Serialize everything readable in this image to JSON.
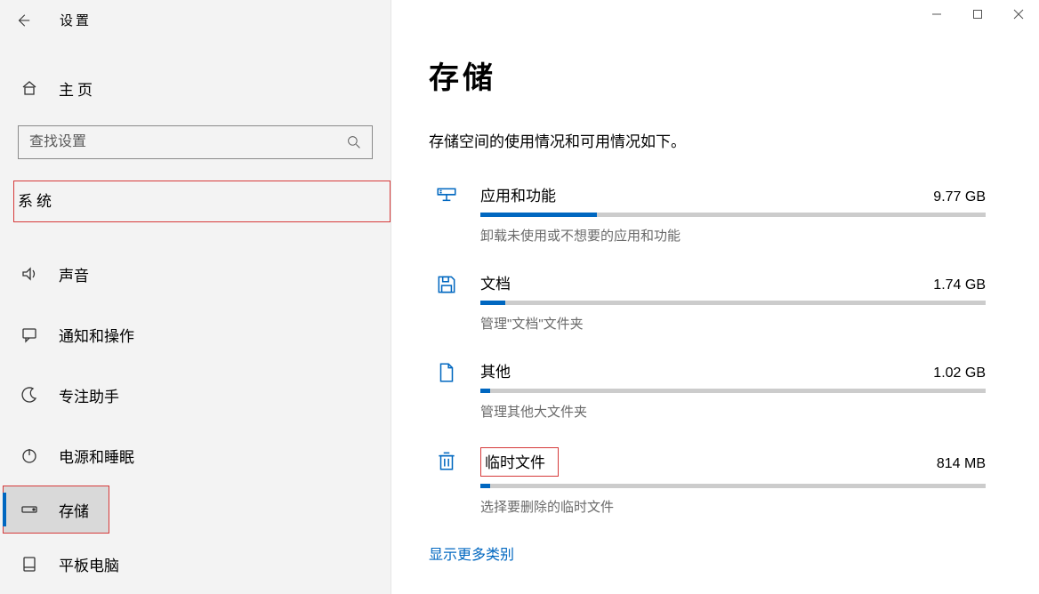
{
  "header": {
    "settings_label": "设置"
  },
  "home": {
    "label": "主页"
  },
  "search": {
    "placeholder": "查找设置"
  },
  "category_label": "系统",
  "nav": [
    {
      "key": "sound",
      "label": "声音"
    },
    {
      "key": "notify",
      "label": "通知和操作"
    },
    {
      "key": "focus",
      "label": "专注助手"
    },
    {
      "key": "power",
      "label": "电源和睡眠"
    },
    {
      "key": "storage",
      "label": "存储"
    },
    {
      "key": "tablet",
      "label": "平板电脑"
    }
  ],
  "page": {
    "title": "存储",
    "lede": "存储空间的使用情况和可用情况如下。"
  },
  "storage": [
    {
      "key": "apps",
      "title": "应用和功能",
      "size": "9.77 GB",
      "desc": "卸载未使用或不想要的应用和功能",
      "fill_pct": 23
    },
    {
      "key": "docs",
      "title": "文档",
      "size": "1.74 GB",
      "desc": "管理\"文档\"文件夹",
      "fill_pct": 5
    },
    {
      "key": "other",
      "title": "其他",
      "size": "1.02 GB",
      "desc": "管理其他大文件夹",
      "fill_pct": 2
    },
    {
      "key": "temp",
      "title": "临时文件",
      "size": "814 MB",
      "desc": "选择要删除的临时文件",
      "fill_pct": 2
    }
  ],
  "more_link": "显示更多类别"
}
